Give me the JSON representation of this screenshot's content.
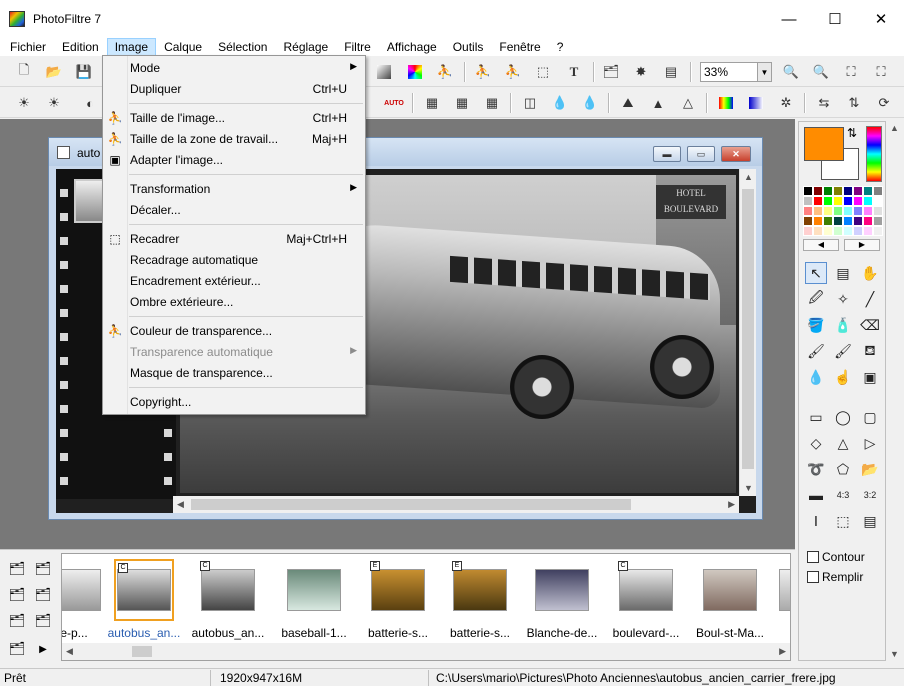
{
  "window": {
    "title": "PhotoFiltre 7",
    "minimize": "—",
    "maximize": "☐",
    "close": "✕"
  },
  "menubar": [
    "Fichier",
    "Edition",
    "Image",
    "Calque",
    "Sélection",
    "Réglage",
    "Filtre",
    "Affichage",
    "Outils",
    "Fenêtre",
    "?"
  ],
  "toolbar": {
    "zoom": "33%"
  },
  "document": {
    "title": "auto",
    "hotel_sign": "HOTEL BOULEVARD"
  },
  "image_menu": [
    {
      "label": "Mode",
      "shortcut": "",
      "submenu": true,
      "icon": ""
    },
    {
      "label": "Dupliquer",
      "shortcut": "Ctrl+U",
      "submenu": false,
      "icon": ""
    },
    {
      "label": "Taille de l'image...",
      "shortcut": "Ctrl+H",
      "submenu": false,
      "icon": "image-size-icon"
    },
    {
      "label": "Taille de la zone de travail...",
      "shortcut": "Maj+H",
      "submenu": false,
      "icon": "canvas-size-icon"
    },
    {
      "label": "Adapter l'image...",
      "shortcut": "",
      "submenu": false,
      "icon": "fit-image-icon"
    },
    {
      "label": "Transformation",
      "shortcut": "",
      "submenu": true,
      "icon": ""
    },
    {
      "label": "Décaler...",
      "shortcut": "",
      "submenu": false,
      "icon": ""
    },
    {
      "label": "Recadrer",
      "shortcut": "Maj+Ctrl+H",
      "submenu": false,
      "icon": "crop-icon"
    },
    {
      "label": "Recadrage automatique",
      "shortcut": "",
      "submenu": false,
      "icon": ""
    },
    {
      "label": "Encadrement extérieur...",
      "shortcut": "",
      "submenu": false,
      "icon": ""
    },
    {
      "label": "Ombre extérieure...",
      "shortcut": "",
      "submenu": false,
      "icon": ""
    },
    {
      "label": "Couleur de transparence...",
      "shortcut": "",
      "submenu": false,
      "icon": "transparency-color-icon"
    },
    {
      "label": "Transparence automatique",
      "shortcut": "",
      "submenu": true,
      "icon": "",
      "disabled": true
    },
    {
      "label": "Masque de transparence...",
      "shortcut": "",
      "submenu": false,
      "icon": ""
    },
    {
      "label": "Copyright...",
      "shortcut": "",
      "submenu": false,
      "icon": ""
    }
  ],
  "palette": {
    "fg_color": "#ff8c00",
    "bg_color": "#ffffff",
    "options": {
      "contour": "Contour",
      "remplir": "Remplir"
    }
  },
  "browser": {
    "thumbnails": [
      {
        "label": "e-p...",
        "badge": "",
        "selected": false
      },
      {
        "label": "autobus_an...",
        "badge": "C",
        "selected": true
      },
      {
        "label": "autobus_an...",
        "badge": "C",
        "selected": false
      },
      {
        "label": "baseball-1...",
        "badge": "",
        "selected": false
      },
      {
        "label": "batterie-s...",
        "badge": "E",
        "selected": false
      },
      {
        "label": "batterie-s...",
        "badge": "E",
        "selected": false
      },
      {
        "label": "Blanche-de...",
        "badge": "",
        "selected": false
      },
      {
        "label": "boulevard-...",
        "badge": "C",
        "selected": false
      },
      {
        "label": "Boul-st-Ma...",
        "badge": "",
        "selected": false
      },
      {
        "label": "B",
        "badge": "",
        "selected": false
      }
    ]
  },
  "status": {
    "state": "Prêt",
    "dimensions": "1920x947x16M",
    "path": "C:\\Users\\mario\\Pictures\\Photo Anciennes\\autobus_ancien_carrier_frere.jpg"
  }
}
